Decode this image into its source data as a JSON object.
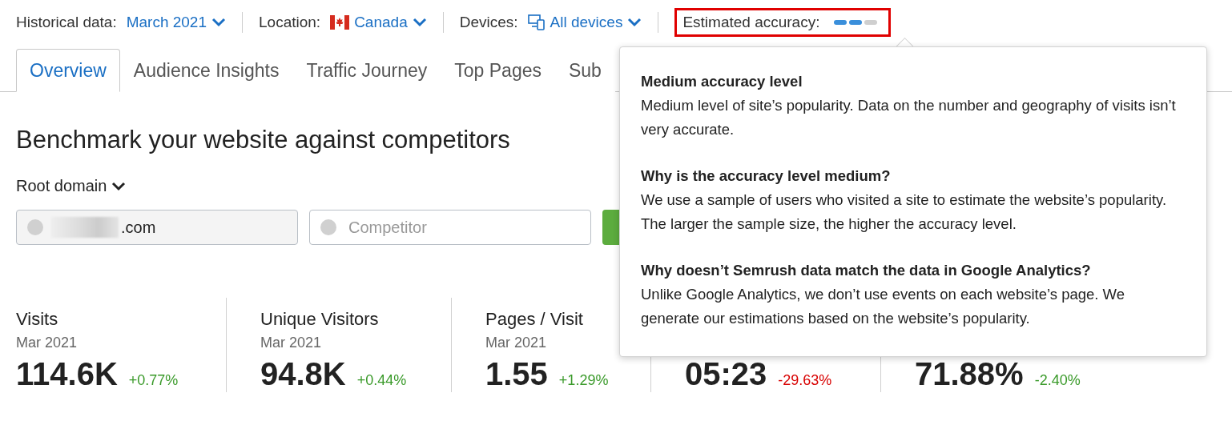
{
  "filters": [
    {
      "kind": "date",
      "label": "Historical data:",
      "value": "March 2021"
    },
    {
      "kind": "location",
      "label": "Location:",
      "value": "Canada"
    },
    {
      "kind": "devices",
      "label": "Devices:",
      "value": "All devices"
    }
  ],
  "accuracy": {
    "label": "Estimated accuracy:",
    "highlighted": true,
    "segments": [
      {
        "on": true
      },
      {
        "on": true
      },
      {
        "on": false
      }
    ]
  },
  "tabs": [
    {
      "label": "Overview",
      "selected": true
    },
    {
      "label": "Audience Insights",
      "selected": false
    },
    {
      "label": "Traffic Journey",
      "selected": false
    },
    {
      "label": "Top Pages",
      "selected": false
    },
    {
      "label": "Sub",
      "selected": false
    }
  ],
  "heading": "Benchmark your website against competitors",
  "scope": {
    "label": "Root domain"
  },
  "domain_field": {
    "value": ".com"
  },
  "competitor_field": {
    "placeholder": "Competitor"
  },
  "metrics": [
    {
      "title": "Visits",
      "period": "Mar 2021",
      "value": "114.6K",
      "change": "+0.77%",
      "color": "#3a9a2a"
    },
    {
      "title": "Unique Visitors",
      "period": "Mar 2021",
      "value": "94.8K",
      "change": "+0.44%",
      "color": "#3a9a2a"
    },
    {
      "title": "Pages / Visit",
      "period": "Mar 2021",
      "value": "1.55",
      "change": "+1.29%",
      "color": "#3a9a2a"
    },
    {
      "value": "05:23",
      "change": "-29.63%",
      "color": "#d80000"
    },
    {
      "value": "71.88%",
      "change": "-2.40%",
      "color": "#3a9a2a"
    }
  ],
  "popover": {
    "sections": [
      {
        "title": "Medium accuracy level",
        "text": "Medium level of site’s popularity. Data on the number and geography of visits isn’t very accurate."
      },
      {
        "title": "Why is the accuracy level medium?",
        "text": "We use a sample of users who visited a site to estimate the website’s popularity. The larger the sample size, the higher the accuracy level."
      },
      {
        "title": "Why doesn’t Semrush data match the data in Google Analytics?",
        "text": "Unlike Google Analytics, we don’t use events on each website’s page. We generate our estimations based on the website’s popularity."
      }
    ]
  }
}
